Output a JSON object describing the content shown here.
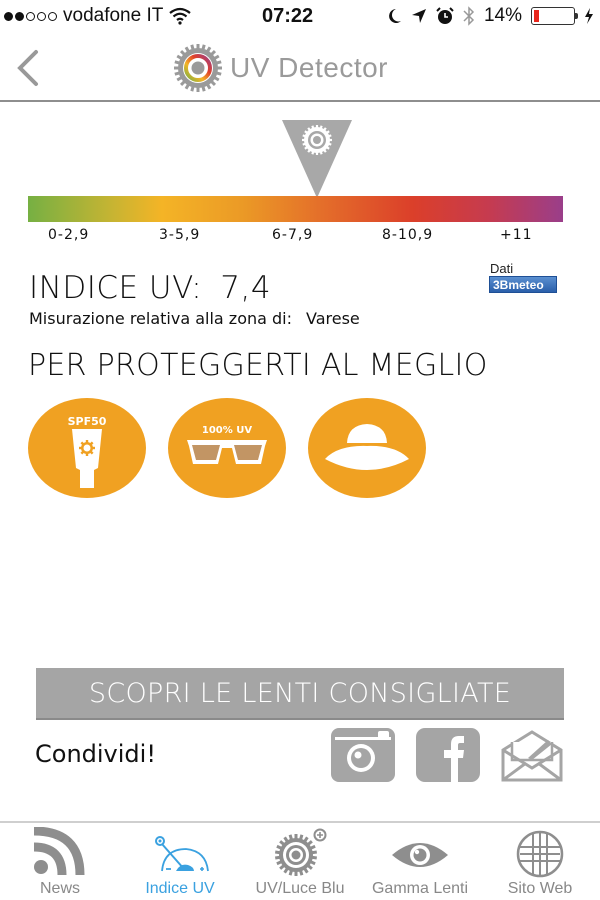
{
  "status_bar": {
    "signal_filled": 2,
    "signal_total": 5,
    "carrier": "vodafone IT",
    "time": "07:22",
    "battery_percent_label": "14%",
    "battery_level": 0.14,
    "icons": [
      "wifi-icon",
      "moon-icon",
      "location-arrow-icon",
      "alarm-icon",
      "bluetooth-icon",
      "battery-icon",
      "charging-bolt-icon"
    ]
  },
  "header": {
    "back_icon": "chevron-left-icon",
    "logo_icon": "uv-gear-logo-icon",
    "title": "UV Detector"
  },
  "uv_scale": {
    "ranges": [
      "0-2,9",
      "3-5,9",
      "6-7,9",
      "8-10,9",
      "+11"
    ],
    "pointer_value": 7.4,
    "colors": {
      "low": "#76b043",
      "moderate": "#f4b426",
      "high": "#e46e2a",
      "very_high": "#db3f2a",
      "extreme": "#9a3e8a"
    }
  },
  "uv_reading": {
    "label": "INDICE UV:",
    "value": "7,4",
    "zone_label": "Misurazione relativa alla zona di:",
    "zone": "Varese",
    "source_label": "Dati",
    "source_logo": "3Bmeteo"
  },
  "protection": {
    "title": "PER PROTEGGERTI AL MEGLIO",
    "items": [
      {
        "name": "sunscreen",
        "icon": "sunscreen-icon",
        "badge": "SPF50"
      },
      {
        "name": "sunglasses",
        "icon": "sunglasses-icon",
        "badge": "100% UV"
      },
      {
        "name": "hat",
        "icon": "hat-icon",
        "badge": ""
      }
    ],
    "accent": "#f0a122"
  },
  "cta": {
    "label": "SCOPRI LE LENTI CONSIGLIATE"
  },
  "share": {
    "label": "Condividi!",
    "buttons": [
      "instagram-icon",
      "facebook-icon",
      "email-icon"
    ]
  },
  "tabbar": {
    "active_color": "#3aa1e0",
    "tabs": [
      {
        "label": "News",
        "icon": "rss-icon",
        "active": false
      },
      {
        "label": "Indice UV",
        "icon": "uv-gauge-icon",
        "active": true
      },
      {
        "label": "UV/Luce Blu",
        "icon": "uv-gear-plus-icon",
        "active": false
      },
      {
        "label": "Gamma Lenti",
        "icon": "eye-icon",
        "active": false
      },
      {
        "label": "Sito Web",
        "icon": "globe-icon",
        "active": false
      }
    ]
  }
}
